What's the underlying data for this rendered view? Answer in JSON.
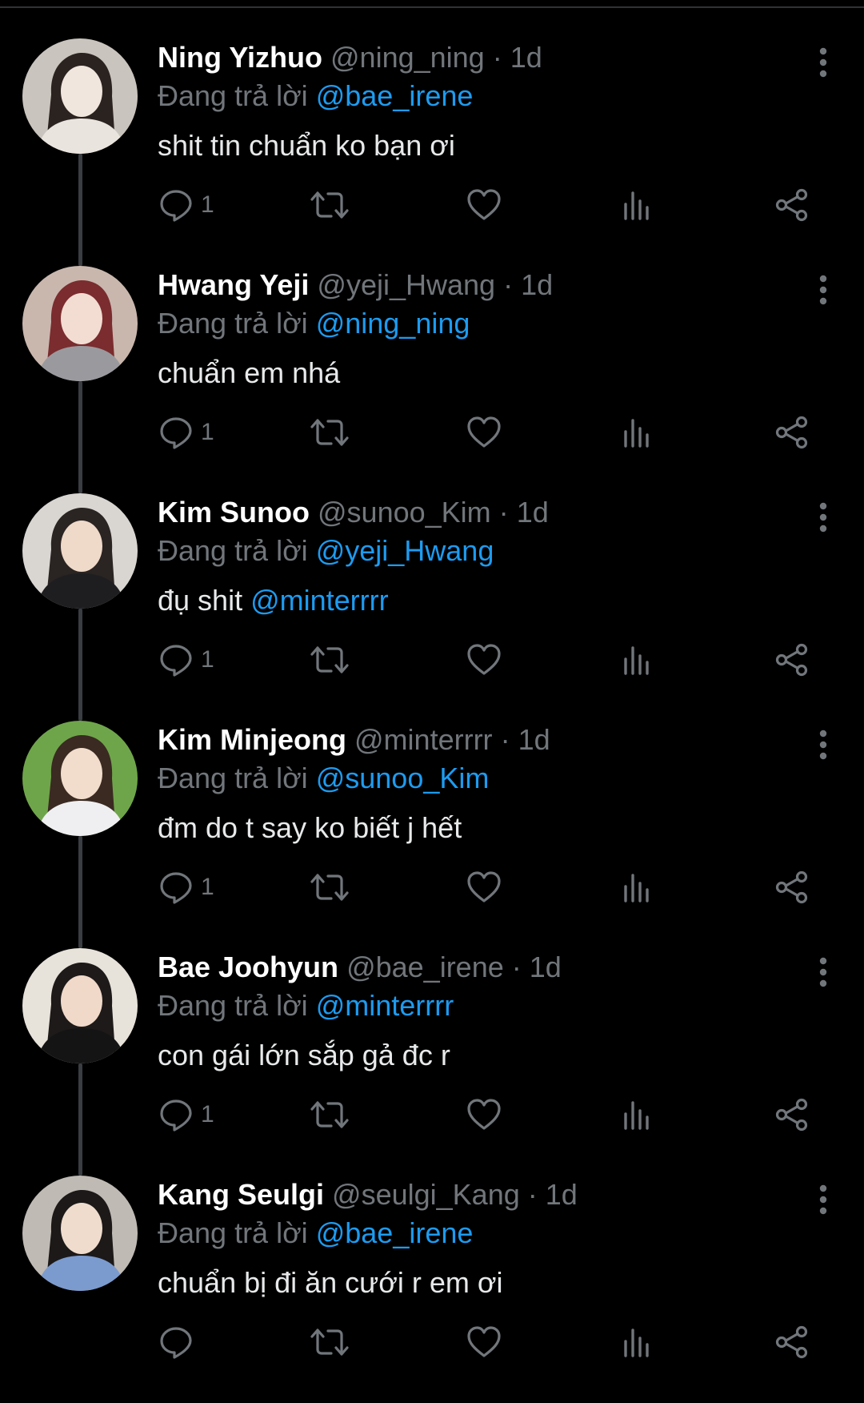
{
  "replying_prefix": "Đang trả lời",
  "colors": {
    "background": "#000000",
    "name": "#ffffff",
    "muted": "#71767b",
    "mention": "#1d9bf0",
    "text": "#e7e9ea"
  },
  "tweets": [
    {
      "display_name": "Ning Yizhuo",
      "handle": "@ning_ning",
      "time": "1d",
      "replying_to": "@bae_irene",
      "text": "shit tin chuẩn ko bạn ơi",
      "mention_in_text": "",
      "reply_count": "1",
      "avatar_colors": [
        "#c9c4bd",
        "#f1e6dd",
        "#2b2320",
        "#e9e4de"
      ]
    },
    {
      "display_name": "Hwang Yeji",
      "handle": "@yeji_Hwang",
      "time": "1d",
      "replying_to": "@ning_ning",
      "text": "chuẩn em nhá",
      "mention_in_text": "",
      "reply_count": "1",
      "avatar_colors": [
        "#c9b7ae",
        "#f3ddd3",
        "#7a2c2e",
        "#9a9a9e"
      ]
    },
    {
      "display_name": "Kim Sunoo",
      "handle": "@sunoo_Kim",
      "time": "1d",
      "replying_to": "@yeji_Hwang",
      "text": "đụ shit",
      "mention_in_text": "@minterrrr",
      "reply_count": "1",
      "avatar_colors": [
        "#d9d6d2",
        "#efd9c8",
        "#2a2422",
        "#1e1e20"
      ]
    },
    {
      "display_name": "Kim Minjeong",
      "handle": "@minterrrr",
      "time": "1d",
      "replying_to": "@sunoo_Kim",
      "text": "đm do t say ko biết j hết",
      "mention_in_text": "",
      "reply_count": "1",
      "avatar_colors": [
        "#6fa54a",
        "#f2dccb",
        "#3a2a22",
        "#efeff1"
      ]
    },
    {
      "display_name": "Bae Joohyun",
      "handle": "@bae_irene",
      "time": "1d",
      "replying_to": "@minterrrr",
      "text": "con gái lớn sắp gả đc r",
      "mention_in_text": "",
      "reply_count": "1",
      "avatar_colors": [
        "#e7e2da",
        "#f0d9c9",
        "#1d1a19",
        "#141414"
      ]
    },
    {
      "display_name": "Kang Seulgi",
      "handle": "@seulgi_Kang",
      "time": "1d",
      "replying_to": "@bae_irene",
      "text": "chuẩn bị đi ăn cưới r em ơi",
      "mention_in_text": "",
      "reply_count": "",
      "avatar_colors": [
        "#bfbab4",
        "#efdccd",
        "#1c1918",
        "#7b9bcf"
      ]
    }
  ]
}
